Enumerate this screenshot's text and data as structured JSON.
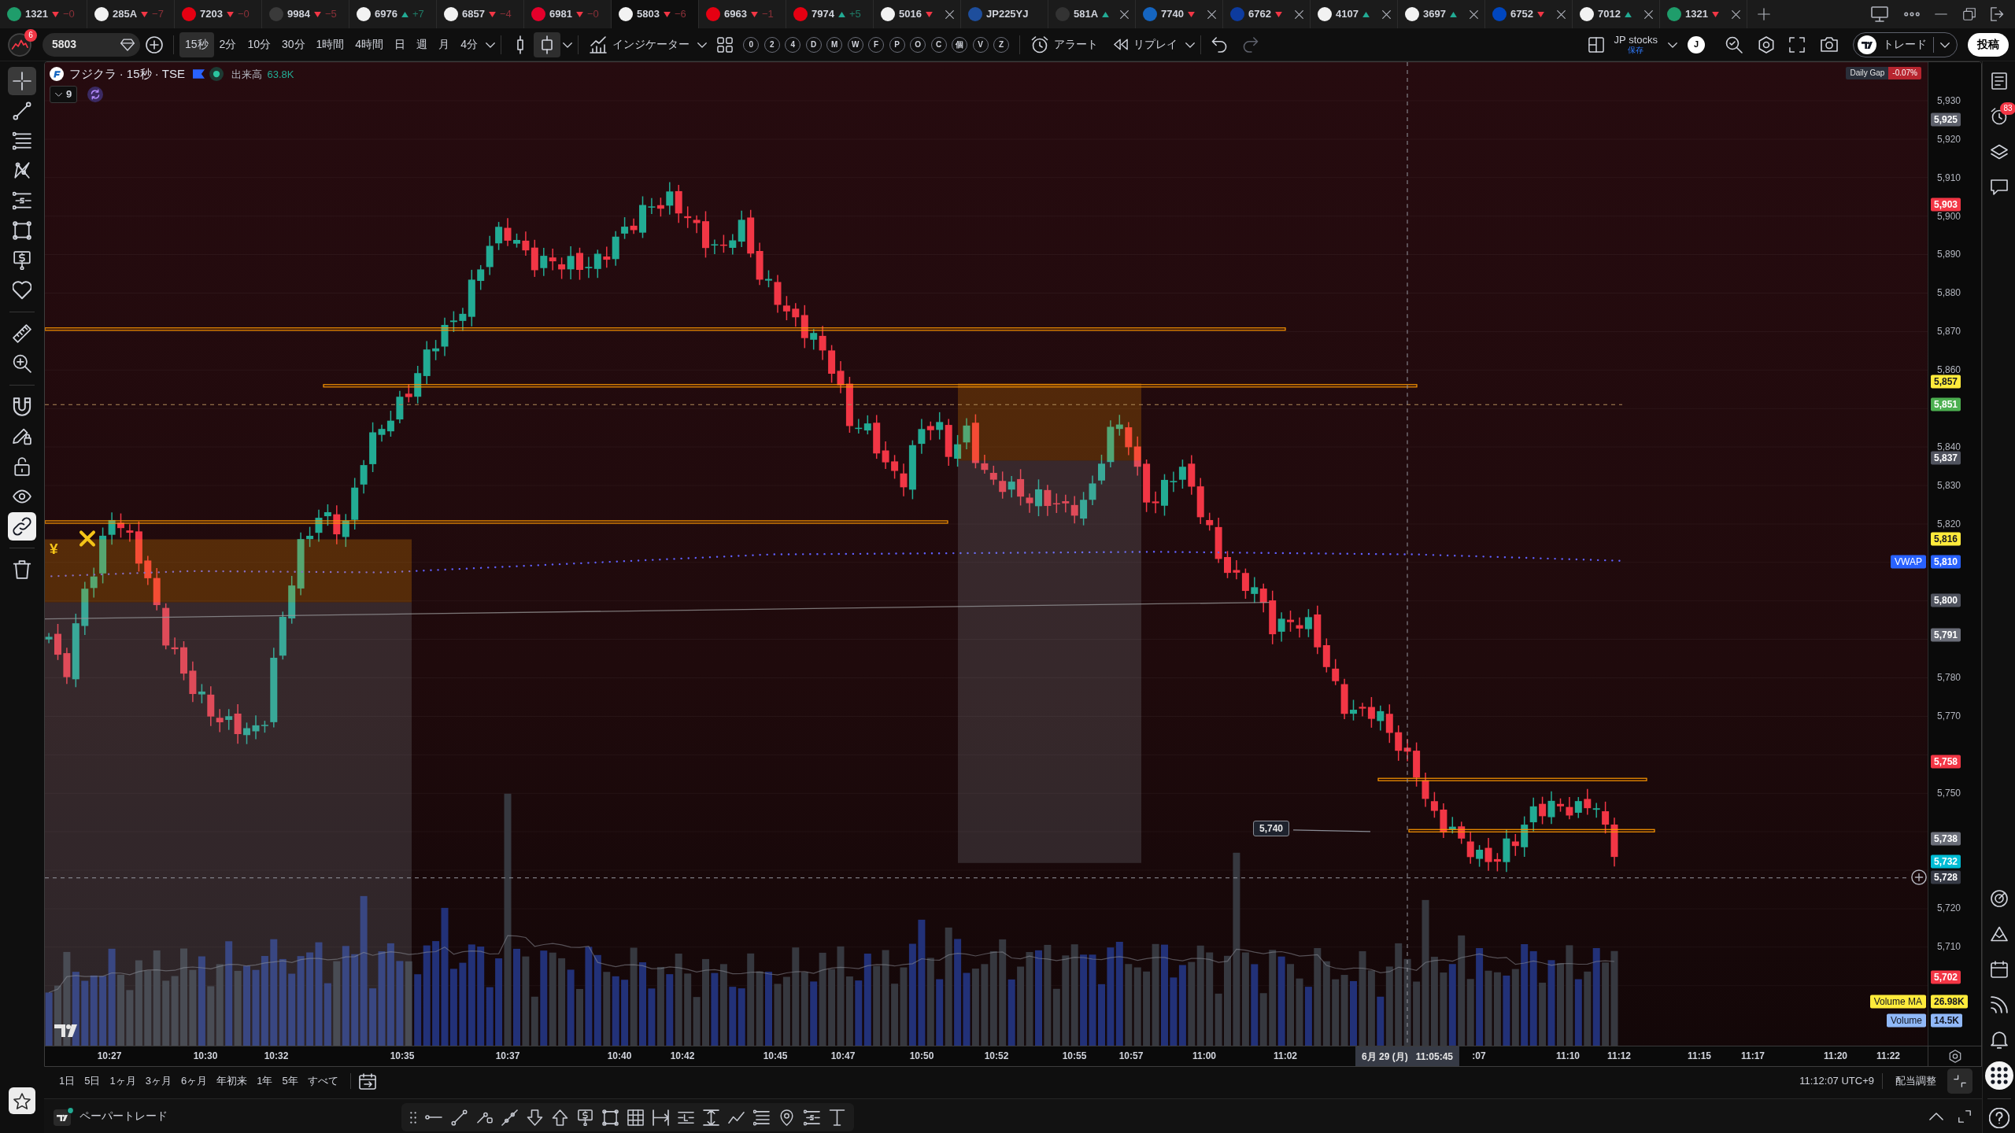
{
  "tabs": [
    {
      "symbol": "1321",
      "rising": false,
      "change": "−0",
      "closable": false,
      "selected": false,
      "color": "#1f9d6b"
    },
    {
      "symbol": "285A",
      "rising": false,
      "change": "−7",
      "closable": false,
      "selected": false,
      "color": "#f2f2f2"
    },
    {
      "symbol": "7203",
      "rising": false,
      "change": "−0",
      "closable": false,
      "selected": false,
      "color": "#e50012"
    },
    {
      "symbol": "9984",
      "rising": false,
      "change": "−5",
      "closable": false,
      "selected": false,
      "color": "#3a3a3a"
    },
    {
      "symbol": "6976",
      "rising": true,
      "change": "+7",
      "closable": false,
      "selected": false,
      "color": "#f2f2f2"
    },
    {
      "symbol": "6857",
      "rising": false,
      "change": "−4",
      "closable": false,
      "selected": false,
      "color": "#f2f2f2"
    },
    {
      "symbol": "6981",
      "rising": false,
      "change": "−0",
      "closable": false,
      "selected": false,
      "color": "#e4002b"
    },
    {
      "symbol": "5803",
      "rising": false,
      "change": "−6",
      "closable": false,
      "selected": true,
      "color": "#f2f2f2"
    },
    {
      "symbol": "6963",
      "rising": false,
      "change": "−1",
      "closable": false,
      "selected": false,
      "color": "#e60012"
    },
    {
      "symbol": "7974",
      "rising": true,
      "change": "+5",
      "closable": false,
      "selected": false,
      "color": "#e60012"
    },
    {
      "symbol": "5016",
      "rising": false,
      "closable": true,
      "selected": false,
      "color": "#f2f2f2"
    },
    {
      "symbol": "JP225YJ",
      "closable": false,
      "selected": false,
      "color": "#1e4e9c"
    },
    {
      "symbol": "581A",
      "rising": true,
      "closable": true,
      "selected": false,
      "color": "#333333"
    },
    {
      "symbol": "7740",
      "rising": false,
      "closable": true,
      "selected": false,
      "color": "#1565c0"
    },
    {
      "symbol": "6762",
      "rising": false,
      "closable": true,
      "selected": false,
      "color": "#0d3b9e"
    },
    {
      "symbol": "4107",
      "rising": true,
      "closable": true,
      "selected": false,
      "color": "#f2f2f2"
    },
    {
      "symbol": "3697",
      "rising": true,
      "closable": true,
      "selected": false,
      "color": "#f2f2f2"
    },
    {
      "symbol": "6752",
      "rising": false,
      "closable": true,
      "selected": false,
      "color": "#0046be"
    },
    {
      "symbol": "7012",
      "rising": true,
      "closable": true,
      "selected": false,
      "color": "#f2f2f2"
    },
    {
      "symbol": "1321",
      "rising": false,
      "closable": true,
      "selected": false,
      "color": "#1f9d6b"
    }
  ],
  "toolbar": {
    "avatar_badge": "6",
    "symbol_field": {
      "value": "5803"
    },
    "intervals": [
      {
        "label": "15秒",
        "selected": true
      },
      {
        "label": "2分",
        "selected": false
      },
      {
        "label": "10分",
        "selected": false
      },
      {
        "label": "30分",
        "selected": false
      },
      {
        "label": "1時間",
        "selected": false
      },
      {
        "label": "4時間",
        "selected": false
      },
      {
        "label": "日",
        "selected": false
      },
      {
        "label": "週",
        "selected": false
      },
      {
        "label": "月",
        "selected": false
      },
      {
        "label": "4分",
        "selected": false
      }
    ],
    "chart_types": [
      {
        "kind": "candle-outline",
        "selected": false
      },
      {
        "kind": "candles",
        "selected": true
      }
    ],
    "indicators": "インジケーター",
    "quick_keys": [
      "0",
      "2",
      "4",
      "D",
      "M",
      "W",
      "F",
      "P",
      "O",
      "C",
      "個",
      "V",
      "Z"
    ],
    "alert": "アラート",
    "replay": "リプレイ",
    "layout": {
      "name": "JP stocks",
      "status": "保存"
    },
    "account": "J",
    "trade": "トレード",
    "publish": "投稿"
  },
  "left_toolbar": {
    "tools": [
      {
        "kind": "crosshair",
        "selected": true
      },
      {
        "kind": "trend-line",
        "selected": false
      },
      {
        "kind": "parallel-lines",
        "selected": false
      },
      {
        "kind": "pattern",
        "selected": false
      },
      {
        "kind": "labeled-lines",
        "selected": false
      },
      {
        "kind": "rectangle",
        "selected": false
      },
      {
        "kind": "price-note",
        "selected": false
      },
      {
        "kind": "heart",
        "selected": false
      }
    ],
    "measure_tools": [
      {
        "kind": "ruler",
        "selected": false
      },
      {
        "kind": "zoom-in",
        "selected": false
      }
    ],
    "toggles": [
      {
        "kind": "magnet",
        "on": false
      },
      {
        "kind": "pencil-lock",
        "on": false
      },
      {
        "kind": "lock",
        "on": false
      },
      {
        "kind": "eye",
        "on": false
      },
      {
        "kind": "link",
        "on": true
      }
    ],
    "actions": [
      {
        "kind": "trash"
      }
    ]
  },
  "chart": {
    "legend": {
      "title": "フジクラ · 15秒 · TSE",
      "volume_label": "出来高",
      "volume_value": "63.8K",
      "indicator_count": "9"
    },
    "daily_gap": {
      "label": "Daily Gap",
      "value": "-0.07%"
    },
    "currency_mark": "¥",
    "price_label": "5,740",
    "price_axis": {
      "ticks": [
        "5,930",
        "5,920",
        "5,910",
        "5,900",
        "5,890",
        "5,880",
        "5,870",
        "5,860",
        "5,840",
        "5,830",
        "5,820",
        "5,780",
        "5,770",
        "5,750",
        "5,720",
        "5,710"
      ],
      "badges": [
        {
          "text": "5,925",
          "color": "#5d606b"
        },
        {
          "text": "5,903",
          "color": "#f23645"
        },
        {
          "text": "5,857",
          "color": "#ffeb3b"
        },
        {
          "text": "5,851",
          "color": "#4caf50"
        },
        {
          "text": "5,837",
          "color": "#50535e"
        },
        {
          "text": "5,816",
          "color": "#ffeb3b"
        },
        {
          "text": "5,810",
          "color": "#2962ff",
          "tag": "VWAP"
        },
        {
          "text": "5,800",
          "color": "#50535e"
        },
        {
          "text": "5,791",
          "color": "#6a6d78"
        },
        {
          "text": "5,758",
          "color": "#f23645"
        },
        {
          "text": "5,738",
          "color": "#6a6d78"
        },
        {
          "text": "5,732",
          "color": "#00bcd4"
        },
        {
          "text": "5,728",
          "color": "#363a45"
        },
        {
          "text": "5,702",
          "color": "#f23645"
        },
        {
          "text": "26.98K",
          "color": "#ffeb3b",
          "tag": "Volume MA"
        },
        {
          "text": "14.5K",
          "color": "#90b8f8",
          "tag": "Volume"
        }
      ]
    },
    "time_axis": {
      "labels": [
        "10:27",
        "10:30",
        "10:32",
        "10:35",
        "10:37",
        "10:40",
        "10:42",
        "10:45",
        "10:47",
        "10:50",
        "10:52",
        "10:55",
        "10:57",
        "11:00",
        "11:02",
        ":07",
        "11:10",
        "11:12",
        "11:15",
        "11:17",
        "11:20",
        "11:22"
      ],
      "crosshair_date": "6月 29 (月)",
      "crosshair_time": "11:05:45"
    }
  },
  "range_bar": {
    "ranges": [
      "1日",
      "5日",
      "1ヶ月",
      "3ヶ月",
      "6ヶ月",
      "年初来",
      "1年",
      "5年",
      "すべて"
    ],
    "clock": "11:12:07 UTC+9",
    "adjustment": "配当調整"
  },
  "bottom_panel": {
    "title": "ペーパートレード"
  },
  "right_sidebar": {
    "top_items": [
      {
        "kind": "watchlist",
        "selected": false
      },
      {
        "kind": "alerts",
        "selected": false,
        "badge": "83"
      },
      {
        "kind": "layers",
        "selected": false
      },
      {
        "kind": "chat",
        "selected": false
      }
    ],
    "bottom_items": [
      {
        "kind": "target",
        "selected": false
      },
      {
        "kind": "ideas",
        "selected": false
      },
      {
        "kind": "calendar",
        "selected": false
      },
      {
        "kind": "signal",
        "selected": false
      },
      {
        "kind": "bell",
        "selected": false
      },
      {
        "kind": "apps",
        "selected": true
      }
    ]
  }
}
